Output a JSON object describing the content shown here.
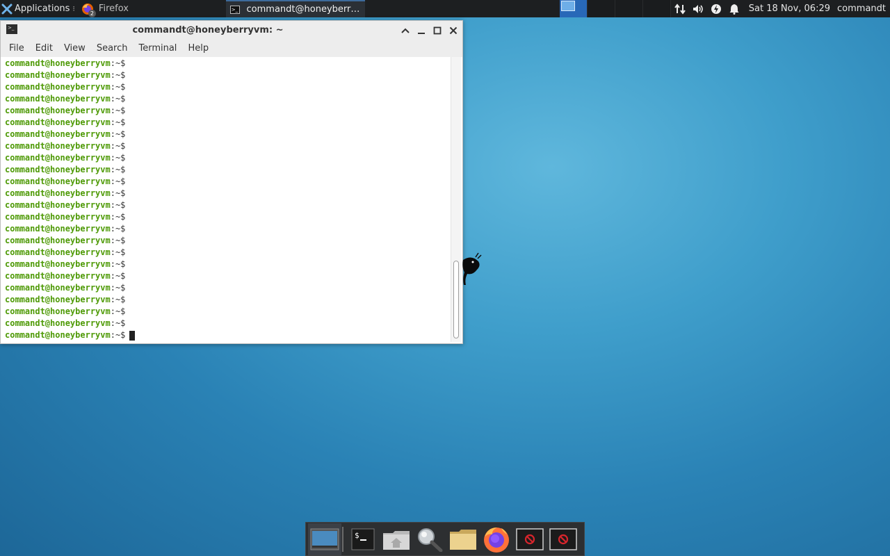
{
  "top_panel": {
    "applications_label": "Applications",
    "applications_icon": "xfce-mouse-icon",
    "tasks": [
      {
        "label": "Firefox",
        "badge": "2",
        "icon": "firefox-icon"
      },
      {
        "label": "commandt@honeyberry...",
        "icon": "terminal-icon"
      }
    ],
    "clock": "Sat 18 Nov, 06:29",
    "user": "commandt"
  },
  "terminal_window": {
    "title": "commandt@honeyberryvm: ~",
    "menu": [
      "File",
      "Edit",
      "View",
      "Search",
      "Terminal",
      "Help"
    ],
    "prompt_user": "commandt@honeyberryvm",
    "prompt_path": ":~$",
    "line_count": 24,
    "colors": {
      "prompt_user": "#4e9a06",
      "background": "#ffffff"
    }
  },
  "dock": {
    "items": [
      "show-desktop",
      "terminal",
      "home-folder",
      "app-finder",
      "file-manager",
      "firefox",
      "blocked-launcher",
      "blocked-launcher"
    ]
  },
  "colors": {
    "panel": "#1d1f21",
    "desktop": "#2a82b5",
    "active_workspace": "#2868b8"
  }
}
